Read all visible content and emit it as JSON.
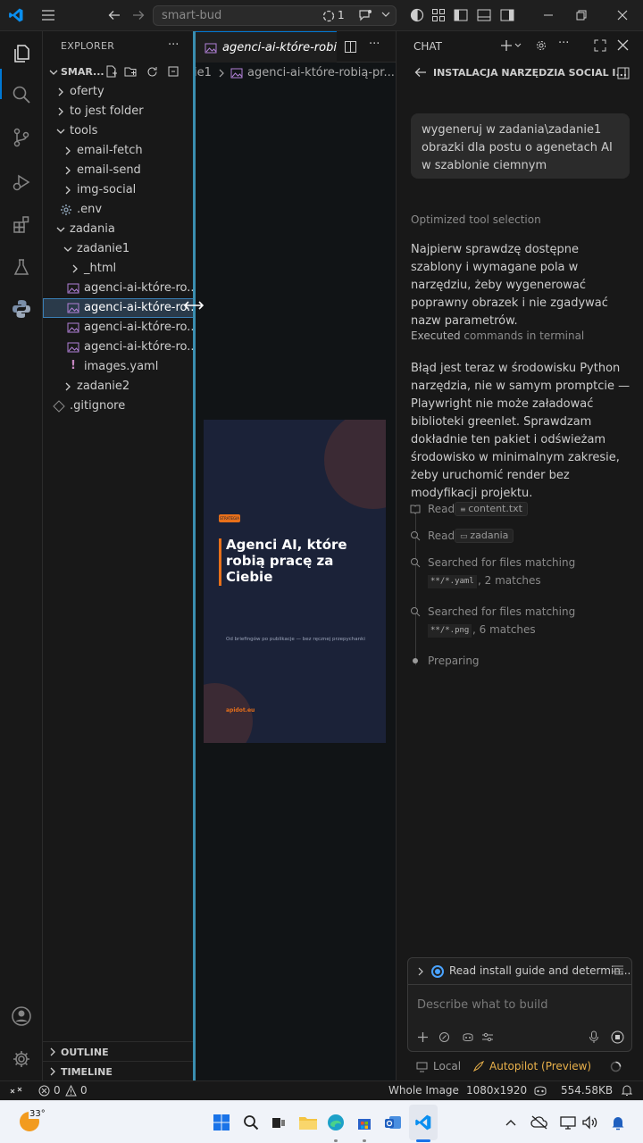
{
  "titlebar": {
    "search_title": "smart-bud",
    "agent_count": "1"
  },
  "explorer": {
    "header": "EXPLORER",
    "root_label": "SMAR...",
    "items": [
      {
        "label": "oferty"
      },
      {
        "label": "to jest folder"
      },
      {
        "label": "tools"
      },
      {
        "label": "email-fetch"
      },
      {
        "label": "email-send"
      },
      {
        "label": "img-social"
      },
      {
        "label": ".env"
      },
      {
        "label": "zadania"
      },
      {
        "label": "zadanie1"
      },
      {
        "label": "_html"
      },
      {
        "label": "agenci-ai-które-ro..."
      },
      {
        "label": "agenci-ai-które-ro..."
      },
      {
        "label": "agenci-ai-które-ro..."
      },
      {
        "label": "agenci-ai-które-ro..."
      },
      {
        "label": "images.yaml"
      },
      {
        "label": "zadanie2"
      },
      {
        "label": ".gitignore"
      }
    ],
    "outline": "OUTLINE",
    "timeline": "TIMELINE"
  },
  "editor": {
    "tab_label": "agenci-ai-które-robią-",
    "breadcrumb_prefix": "ie1",
    "breadcrumb_file": "agenci-ai-które-robią-pr...",
    "poster": {
      "tag": "STRATEGIA",
      "title": "Agenci AI, które robią pracę za Ciebie",
      "subtitle": "Od briefingów po publikacje — bez ręcznej przepychanki",
      "brand": "apidot.eu"
    }
  },
  "chat": {
    "header": "CHAT",
    "session_title": "INSTALACJA NARZĘDZIA SOCIAL I...",
    "user_message": "wygeneruj w zadania\\zadanie1 obrazki dla postu o agenetach AI w szablonie ciemnym",
    "status1": "Optimized tool selection",
    "para1": "Najpierw sprawdzę dostępne szablony i wymagane pola w narzędziu, żeby wygenerować poprawny obrazek i nie zgadywać nazw parametrów.",
    "status2_a": "Executed",
    "status2_b": " commands in terminal",
    "para2": "Błąd jest teraz w środowisku Python narzędzia, nie w samym promptcie — Playwright nie może załadować biblioteki greenlet. Sprawdzam dokładnie ten pakiet i odświeżam środowisko w minimalnym zakresie, żeby uruchomić render bez modyfikacji projektu.",
    "steps": {
      "read1_label": "Read",
      "read1_file": "content.txt",
      "read2_label": "Read",
      "read2_folder": "zadania",
      "search1_label": "Searched for files matching",
      "search1_pattern": "**/*.yaml",
      "search1_result": ", 2 matches",
      "search2_label": "Searched for files matching",
      "search2_pattern": "**/*.png",
      "search2_result": ", 6 matches",
      "preparing": "Preparing"
    },
    "task_label": "Read install guide and determin...",
    "input_placeholder": "Describe what to build",
    "mode_local": "Local",
    "mode_autopilot": "Autopilot (Preview)"
  },
  "statusbar": {
    "errors": "0",
    "warnings": "0",
    "image_mode": "Whole Image",
    "dimensions": "1080x1920",
    "filesize": "554.58KB"
  },
  "taskbar": {
    "temperature": "33°"
  },
  "colors": {
    "accent": "#0078d4",
    "poster_orange": "#e8701a",
    "poster_bg": "#1b2238",
    "autopilot": "#e8b04a"
  }
}
